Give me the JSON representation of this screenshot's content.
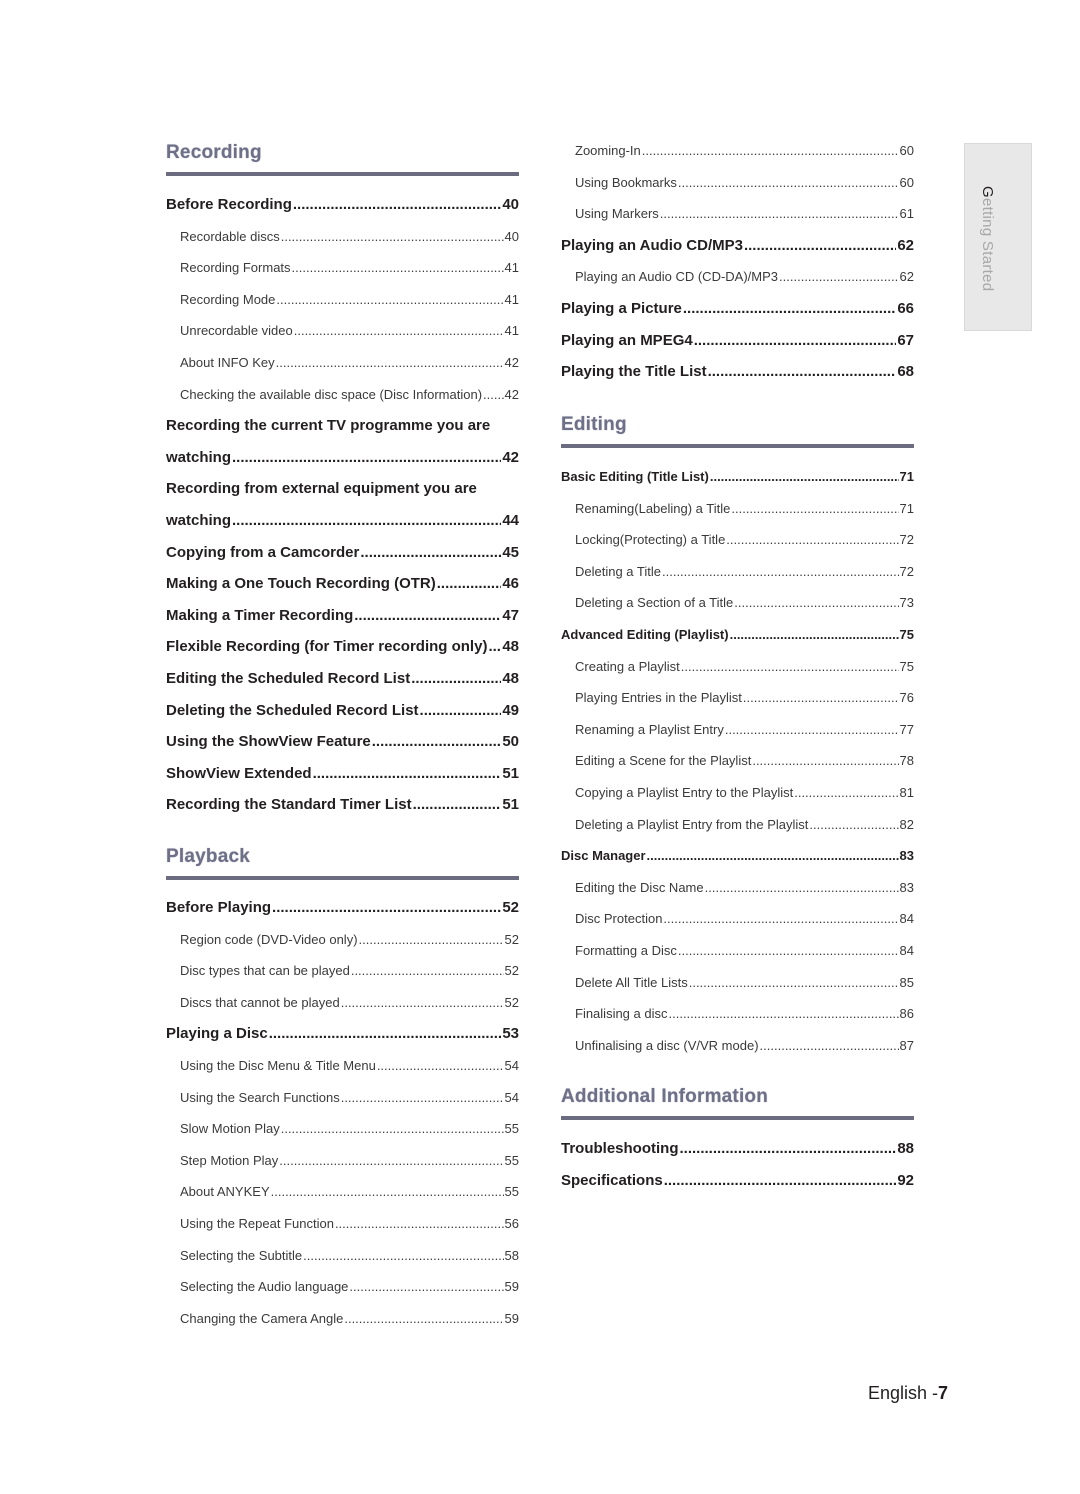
{
  "side_tab": {
    "first_letter": "G",
    "rest": "etting Started"
  },
  "footer": {
    "language": "English -",
    "page_number": "7"
  },
  "left_column": {
    "recording": {
      "title": "Recording",
      "entries": [
        {
          "label": "Before Recording",
          "page": "40",
          "level": "main"
        },
        {
          "label": "Recordable discs",
          "page": "40",
          "level": "sub"
        },
        {
          "label": "Recording Formats ",
          "page": "41",
          "level": "sub"
        },
        {
          "label": "Recording Mode",
          "page": "41",
          "level": "sub"
        },
        {
          "label": "Unrecordable video",
          "page": "41",
          "level": "sub"
        },
        {
          "label": "About INFO Key",
          "page": "42",
          "level": "sub"
        },
        {
          "label": "Checking the available disc space (Disc Information)",
          "page": "42",
          "level": "sub"
        },
        {
          "label": "Recording the current TV programme you are",
          "page": "",
          "level": "wrap"
        },
        {
          "label": "watching ",
          "page": "42",
          "level": "main"
        },
        {
          "label": "Recording from external equipment you are",
          "page": "",
          "level": "wrap"
        },
        {
          "label": "watching ",
          "page": "44",
          "level": "main"
        },
        {
          "label": "Copying from a Camcorder ",
          "page": "45",
          "level": "main"
        },
        {
          "label": "Making a One Touch Recording (OTR)",
          "page": "46",
          "level": "main"
        },
        {
          "label": "Making a Timer Recording",
          "page": "47",
          "level": "main"
        },
        {
          "label": "Flexible Recording (for Timer recording only) ",
          "page": "48",
          "level": "main"
        },
        {
          "label": "Editing the Scheduled Record List",
          "page": "48",
          "level": "main"
        },
        {
          "label": "Deleting the Scheduled Record List",
          "page": "49",
          "level": "main"
        },
        {
          "label": "Using the ShowView Feature",
          "page": "50",
          "level": "main"
        },
        {
          "label": "ShowView Extended",
          "page": "51",
          "level": "main"
        },
        {
          "label": "Recording the Standard Timer List ",
          "page": "51",
          "level": "main"
        }
      ]
    },
    "playback": {
      "title": "Playback",
      "entries": [
        {
          "label": "Before Playing ",
          "page": "52",
          "level": "main"
        },
        {
          "label": "Region code (DVD-Video only)",
          "page": "52",
          "level": "sub"
        },
        {
          "label": "Disc types that can be played",
          "page": "52",
          "level": "sub"
        },
        {
          "label": "Discs that cannot be played",
          "page": "52",
          "level": "sub"
        },
        {
          "label": "Playing a Disc",
          "page": "53",
          "level": "main"
        },
        {
          "label": "Using the Disc Menu & Title Menu ",
          "page": "54",
          "level": "sub"
        },
        {
          "label": "Using the Search Functions",
          "page": "54",
          "level": "sub"
        },
        {
          "label": "Slow Motion Play",
          "page": "55",
          "level": "sub"
        },
        {
          "label": "Step Motion Play",
          "page": "55",
          "level": "sub"
        },
        {
          "label": "About ANYKEY ",
          "page": "55",
          "level": "sub"
        },
        {
          "label": "Using the Repeat Function",
          "page": "56",
          "level": "sub"
        },
        {
          "label": "Selecting the Subtitle ",
          "page": "58",
          "level": "sub"
        },
        {
          "label": "Selecting the Audio language",
          "page": "59",
          "level": "sub"
        },
        {
          "label": "Changing the Camera Angle",
          "page": "59",
          "level": "sub"
        }
      ]
    }
  },
  "right_column": {
    "continued": {
      "entries": [
        {
          "label": "Zooming-In",
          "page": "60",
          "level": "sub"
        },
        {
          "label": "Using Bookmarks",
          "page": "60",
          "level": "sub"
        },
        {
          "label": "Using Markers ",
          "page": "61",
          "level": "sub"
        },
        {
          "label": "Playing an Audio CD/MP3  ",
          "page": "62",
          "level": "main"
        },
        {
          "label": "Playing an Audio CD (CD-DA)/MP3 ",
          "page": "62",
          "level": "sub"
        },
        {
          "label": "Playing a Picture ",
          "page": "66",
          "level": "main"
        },
        {
          "label": "Playing an MPEG4 ",
          "page": "67",
          "level": "main"
        },
        {
          "label": "Playing the Title List",
          "page": "68",
          "level": "main"
        }
      ]
    },
    "editing": {
      "title": "Editing",
      "entries": [
        {
          "label": "Basic Editing (Title List) ",
          "page": "71",
          "level": "mid"
        },
        {
          "label": "Renaming(Labeling) a Title",
          "page": "71",
          "level": "sub"
        },
        {
          "label": "Locking(Protecting) a Title ",
          "page": "72",
          "level": "sub"
        },
        {
          "label": "Deleting a Title",
          "page": "72",
          "level": "sub"
        },
        {
          "label": "Deleting a Section of a Title",
          "page": "73",
          "level": "sub"
        },
        {
          "label": "Advanced Editing (Playlist) ",
          "page": "75",
          "level": "mid"
        },
        {
          "label": "Creating a Playlist ",
          "page": "75",
          "level": "sub"
        },
        {
          "label": "Playing Entries in the Playlist ",
          "page": "76",
          "level": "sub"
        },
        {
          "label": "Renaming a Playlist Entry ",
          "page": "77",
          "level": "sub"
        },
        {
          "label": "Editing a Scene for the Playlist ",
          "page": "78",
          "level": "sub"
        },
        {
          "label": "Copying a Playlist Entry to the Playlist ",
          "page": "81",
          "level": "sub"
        },
        {
          "label": "Deleting a Playlist Entry from the Playlist",
          "page": "82",
          "level": "sub"
        },
        {
          "label": "Disc Manager ",
          "page": "83",
          "level": "mid"
        },
        {
          "label": "Editing the Disc Name ",
          "page": "83",
          "level": "sub"
        },
        {
          "label": "Disc Protection ",
          "page": "84",
          "level": "sub"
        },
        {
          "label": "Formatting a Disc",
          "page": "84",
          "level": "sub"
        },
        {
          "label": "Delete All Title Lists",
          "page": "85",
          "level": "sub"
        },
        {
          "label": "Finalising a disc",
          "page": "86",
          "level": "sub"
        },
        {
          "label": "Unfinalising a disc (V/VR mode) ",
          "page": "87",
          "level": "sub"
        }
      ]
    },
    "additional": {
      "title": "Additional Information",
      "entries": [
        {
          "label": "Troubleshooting ",
          "page": "88",
          "level": "main"
        },
        {
          "label": "Specifications",
          "page": "92",
          "level": "main"
        }
      ]
    }
  }
}
